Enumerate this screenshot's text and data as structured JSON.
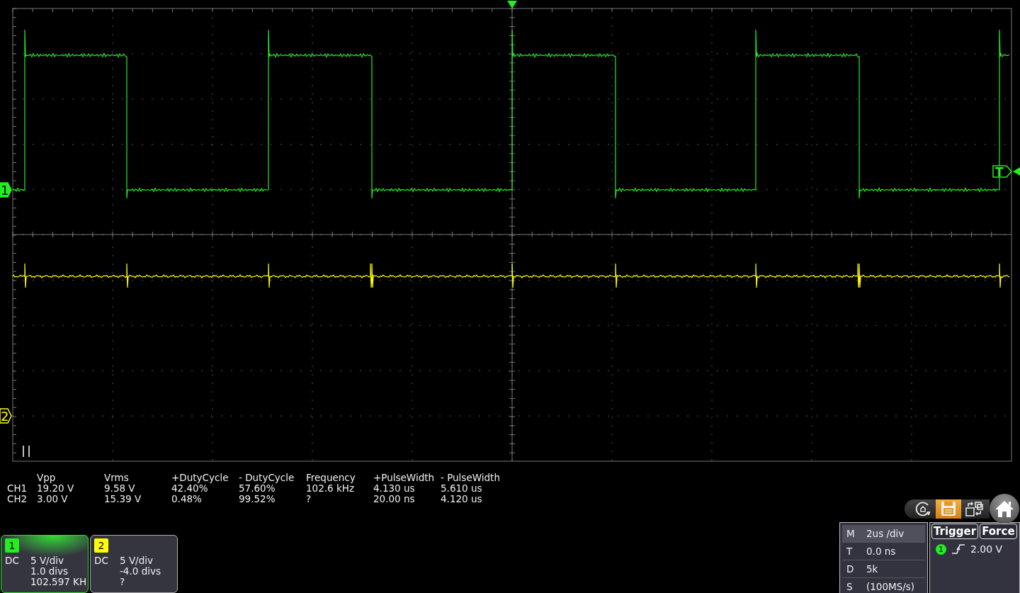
{
  "plot": {
    "channel_markers": [
      {
        "label": "1"
      },
      {
        "label": "2"
      }
    ],
    "trigger_marker": "T"
  },
  "measurements": {
    "columns": [
      "Vpp",
      "Vrms",
      "+DutyCycle",
      "- DutyCycle",
      "Frequency",
      "+PulseWidth",
      "- PulseWidth"
    ],
    "rows": [
      {
        "channel": "CH1",
        "values": [
          "19.20 V",
          "9.58 V",
          "42.40%",
          "57.60%",
          "102.6 kHz",
          "4.130 us",
          "5.610 us"
        ]
      },
      {
        "channel": "CH2",
        "values": [
          "3.00 V",
          "15.39 V",
          "0.48%",
          "99.52%",
          "?",
          "20.00 ns",
          "4.120 us"
        ]
      }
    ]
  },
  "channels": [
    {
      "number": "1",
      "color": "#22ee22",
      "selected": true,
      "coupling": "DC",
      "scale": "5 V/div",
      "offset": "1.0 divs",
      "frequency": "102.597 KH"
    },
    {
      "number": "2",
      "color": "#ffff00",
      "selected": false,
      "coupling": "DC",
      "scale": "5 V/div",
      "offset": "-4.0 divs",
      "frequency": "?"
    }
  ],
  "toolbar": [
    {
      "kind": "restore",
      "selected": false
    },
    {
      "kind": "save",
      "selected": true
    },
    {
      "kind": "swap",
      "selected": false
    },
    {
      "kind": "home",
      "selected": false
    }
  ],
  "timebase": [
    {
      "key": "M",
      "value": "2us /div",
      "selected": true
    },
    {
      "key": "T",
      "value": "0.0 ns",
      "selected": false
    },
    {
      "key": "D",
      "value": "5k",
      "selected": false
    },
    {
      "key": "S",
      "value": "(100MS/s)",
      "selected": false
    }
  ],
  "trigger": {
    "title": "Trigger",
    "force": "Force",
    "source": "1",
    "level": "2.00 V"
  }
}
